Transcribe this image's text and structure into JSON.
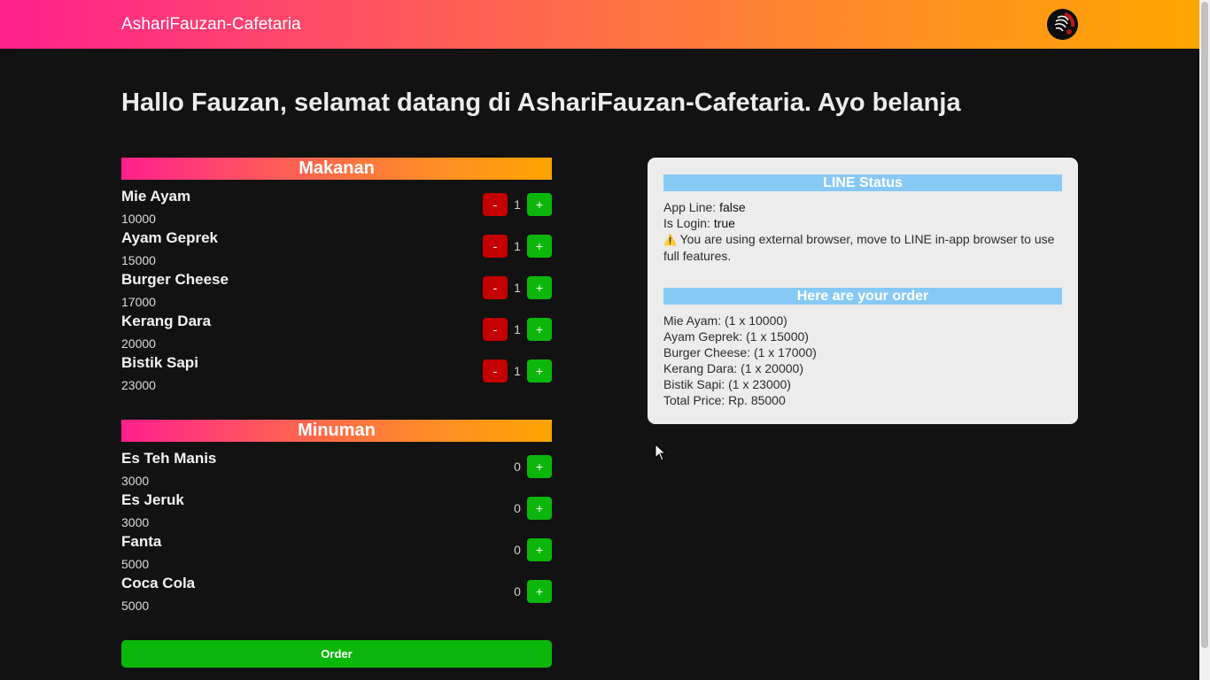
{
  "navbar": {
    "brand": "AshariFauzan-Cafetaria"
  },
  "welcome": "Hallo Fauzan, selamat datang di AshariFauzan-Cafetaria. Ayo belanja",
  "makanan": {
    "title": "Makanan",
    "items": [
      {
        "name": "Mie Ayam",
        "price": "10000",
        "qty": "1"
      },
      {
        "name": "Ayam Geprek",
        "price": "15000",
        "qty": "1"
      },
      {
        "name": "Burger Cheese",
        "price": "17000",
        "qty": "1"
      },
      {
        "name": "Kerang Dara",
        "price": "20000",
        "qty": "1"
      },
      {
        "name": "Bistik Sapi",
        "price": "23000",
        "qty": "1"
      }
    ]
  },
  "minuman": {
    "title": "Minuman",
    "items": [
      {
        "name": "Es Teh Manis",
        "price": "3000",
        "qty": "0"
      },
      {
        "name": "Es Jeruk",
        "price": "3000",
        "qty": "0"
      },
      {
        "name": "Fanta",
        "price": "5000",
        "qty": "0"
      },
      {
        "name": "Coca Cola",
        "price": "5000",
        "qty": "0"
      }
    ]
  },
  "buttons": {
    "minus": "-",
    "plus": "+",
    "order": "Order"
  },
  "line_status": {
    "title": "LINE Status",
    "app_line_label": "App Line: ",
    "app_line_value": "false",
    "is_login_label": "Is Login: ",
    "is_login_value": "true",
    "warning_icon": "⚠️",
    "warning_text": " You are using external browser, move to LINE in-app browser to use full features."
  },
  "order_summary": {
    "title": "Here are your order",
    "lines": [
      "Mie Ayam: (1 x 10000)",
      "Ayam Geprek: (1 x 15000)",
      "Burger Cheese: (1 x 17000)",
      "Kerang Dara: (1 x 20000)",
      "Bistik Sapi: (1 x 23000)",
      "Total Price: Rp. 85000"
    ]
  },
  "colors": {
    "gradient_start": "#ff1f8e",
    "gradient_end": "#ffa500",
    "minus_button": "#c40000",
    "plus_button": "#0bb70b",
    "panel_header": "#87c9f5",
    "background": "#121212"
  }
}
